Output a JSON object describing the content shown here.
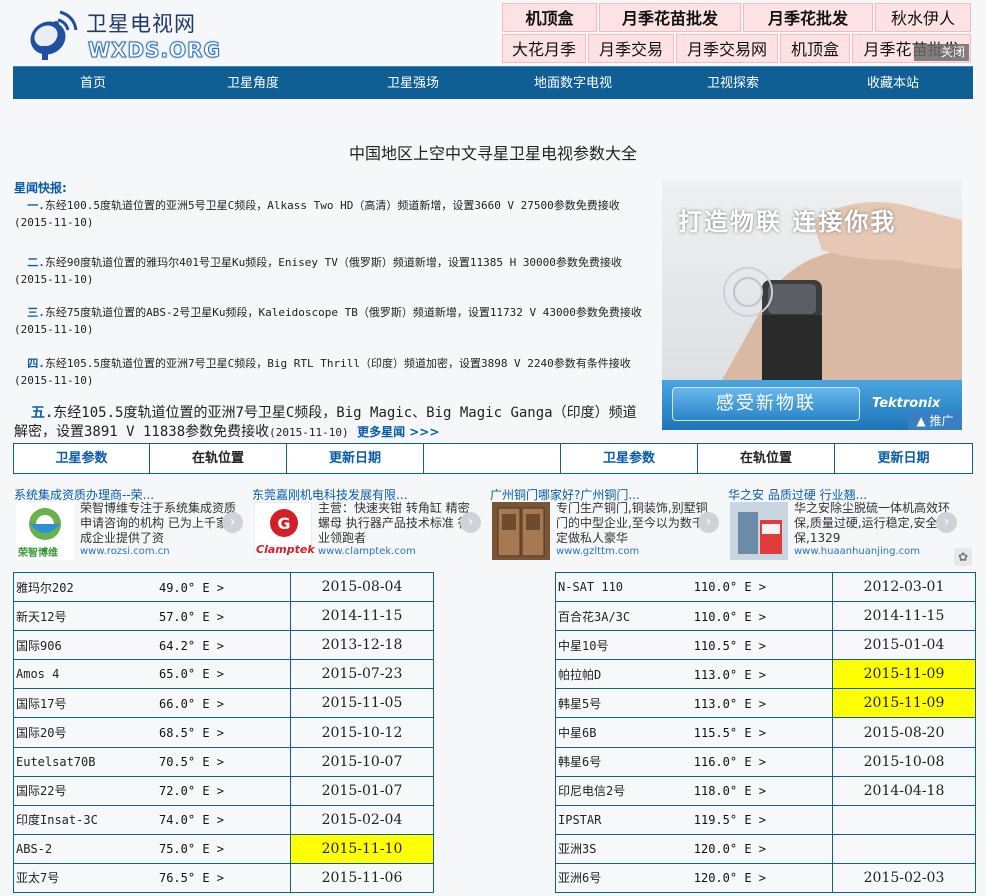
{
  "site": {
    "title": "卫星电视网",
    "domain": "WXDS.ORG"
  },
  "top_ads": {
    "row1": [
      "机顶盒",
      "月季花苗批发",
      "月季花批发",
      "秋水伊人"
    ],
    "row2": [
      "大花月季",
      "月季交易",
      "月季交易网",
      "机顶盒",
      "月季花苗批发"
    ],
    "close": "关闭"
  },
  "nav": [
    "首页",
    "卫星角度",
    "卫星强场",
    "地面数字电视",
    "卫视探索",
    "收藏本站"
  ],
  "page_title": "中国地区上空中文寻星卫星电视参数大全",
  "news": {
    "heading": "星闻快报:",
    "items": [
      {
        "num": "一.",
        "text": "东经100.5度轨道位置的亚洲5号卫星C频段，Alkass Two HD（高清）频道新增，设置3660 V 27500参数免费接收(2015-11-10)"
      },
      {
        "num": "二.",
        "text": "东经90度轨道位置的雅玛尔401号卫星Ku频段，Enisey TV（俄罗斯）频道新增，设置11385 H 30000参数免费接收(2015-11-10)"
      },
      {
        "num": "三.",
        "text": "东经75度轨道位置的ABS-2号卫星Ku频段，Kaleidoscope TB（俄罗斯）频道新增，设置11732 V 43000参数免费接收(2015-11-10)"
      },
      {
        "num": "四.",
        "text": "东经105.5度轨道位置的亚洲7号卫星C频段，Big RTL Thrill（印度）频道加密，设置3898 V 2240参数有条件接收(2015-11-10)"
      },
      {
        "num": "五.",
        "text": "东经105.5度轨道位置的亚洲7号卫星C频段，Big Magic、Big Magic Ganga（印度）频道解密，设置3891 V 11838参数免费接收",
        "date": "(2015-11-10)"
      }
    ],
    "more": "更多星闻 >>>"
  },
  "side_ad": {
    "headline": "打造物联 连接你我",
    "button": "感受新物联",
    "brand": "Tektronix",
    "promo": "推广"
  },
  "table_header": [
    "卫星参数",
    "在轨位置",
    "更新日期",
    "",
    "卫星参数",
    "在轨位置",
    "更新日期"
  ],
  "ads": [
    {
      "title": "系统集成资质办理商--荣...",
      "desc": "荣智博维专注于系统集成资质申请咨询的机构 已为上千家集成企业提供了资",
      "url": "www.rozsi.com.cn",
      "logo_text": "荣智博维"
    },
    {
      "title": "东莞嘉刚机电科技发展有限...",
      "desc": "主营：快速夹钳 转角缸 精密螺母 执行器产品技术标准 行业领跑者",
      "url": "www.clamptek.com",
      "logo_text": "Clamptek"
    },
    {
      "title": "广州铜门哪家好?广州铜门...",
      "desc": "专门生产铜门,铜装饰,别墅铜门的中型企业,至今以为数千家定做私人豪华",
      "url": "www.gzlttm.com",
      "logo_text": ""
    },
    {
      "title": "华之安 品质过硬 行业翘...",
      "desc": "华之安除尘脱硫一体机高效环保,质量过硬,运行稳定,安全环保,1329",
      "url": "www.huaanhuanjing.com",
      "logo_text": ""
    }
  ],
  "left_rows": [
    {
      "name": "雅玛尔202",
      "pos": "49.0° E >",
      "date": "2015-08-04",
      "hi": false
    },
    {
      "name": "新天12号",
      "pos": "57.0° E >",
      "date": "2014-11-15",
      "hi": false
    },
    {
      "name": "国际906",
      "pos": "64.2° E >",
      "date": "2013-12-18",
      "hi": false
    },
    {
      "name": "Amos 4",
      "pos": "65.0° E >",
      "date": "2015-07-23",
      "hi": false
    },
    {
      "name": "国际17号",
      "pos": "66.0° E >",
      "date": "2015-11-05",
      "hi": false
    },
    {
      "name": "国际20号",
      "pos": "68.5° E >",
      "date": "2015-10-12",
      "hi": false
    },
    {
      "name": "Eutelsat70B",
      "pos": "70.5° E >",
      "date": "2015-10-07",
      "hi": false
    },
    {
      "name": "国际22号",
      "pos": "72.0° E >",
      "date": "2015-01-07",
      "hi": false
    },
    {
      "name": "印度Insat-3C",
      "pos": "74.0° E >",
      "date": "2015-02-04",
      "hi": false
    },
    {
      "name": "ABS-2",
      "pos": "75.0° E >",
      "date": "2015-11-10",
      "hi": true
    },
    {
      "name": "亚太7号",
      "pos": "76.5° E >",
      "date": "2015-11-06",
      "hi": false
    }
  ],
  "right_rows": [
    {
      "name": "N-SAT 110",
      "pos": "110.0° E >",
      "date": "2012-03-01",
      "hi": false
    },
    {
      "name": "百合花3A/3C",
      "pos": "110.0° E >",
      "date": "2014-11-15",
      "hi": false
    },
    {
      "name": "中星10号",
      "pos": "110.5° E >",
      "date": "2015-01-04",
      "hi": false
    },
    {
      "name": "帕拉帕D",
      "pos": "113.0° E >",
      "date": "2015-11-09",
      "hi": true
    },
    {
      "name": "韩星5号",
      "pos": "113.0° E >",
      "date": "2015-11-09",
      "hi": true
    },
    {
      "name": "中星6B",
      "pos": "115.5° E >",
      "date": "2015-08-20",
      "hi": false
    },
    {
      "name": "韩星6号",
      "pos": "116.0° E >",
      "date": "2015-10-08",
      "hi": false
    },
    {
      "name": "印尼电信2号",
      "pos": "118.0° E >",
      "date": "2014-04-18",
      "hi": false
    },
    {
      "name": "IPSTAR",
      "pos": "119.5° E >",
      "date": "",
      "hi": false
    },
    {
      "name": "亚洲3S",
      "pos": "120.0° E >",
      "date": "",
      "hi": false
    },
    {
      "name": "亚洲6号",
      "pos": "120.0° E >",
      "date": "2015-02-03",
      "hi": false
    }
  ]
}
